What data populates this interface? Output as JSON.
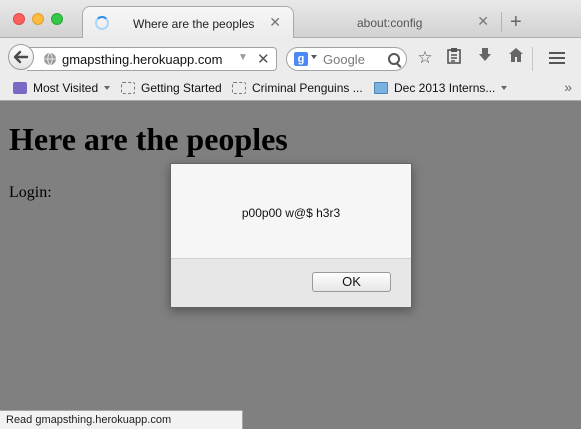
{
  "window": {
    "tabs": [
      {
        "title": "Where are the peoples",
        "active": true,
        "loading": true
      },
      {
        "title": "about:config",
        "active": false
      }
    ]
  },
  "navbar": {
    "url": "gmapsthing.herokuapp.com",
    "search_engine": "Google",
    "search_placeholder": "Google"
  },
  "bookmarks": [
    {
      "label": "Most Visited",
      "icon": "most-visited-icon",
      "dropdown": true
    },
    {
      "label": "Getting Started",
      "icon": "page-icon"
    },
    {
      "label": "Criminal Penguins ...",
      "icon": "page-icon"
    },
    {
      "label": "Dec 2013 Interns...",
      "icon": "folder-icon",
      "dropdown": true
    }
  ],
  "page": {
    "heading": "Here are the peoples",
    "login_label": "Login:"
  },
  "dialog": {
    "message": "p00p00 w@$ h3r3",
    "ok_label": "OK"
  },
  "status": {
    "text": "Read gmapsthing.herokuapp.com"
  }
}
